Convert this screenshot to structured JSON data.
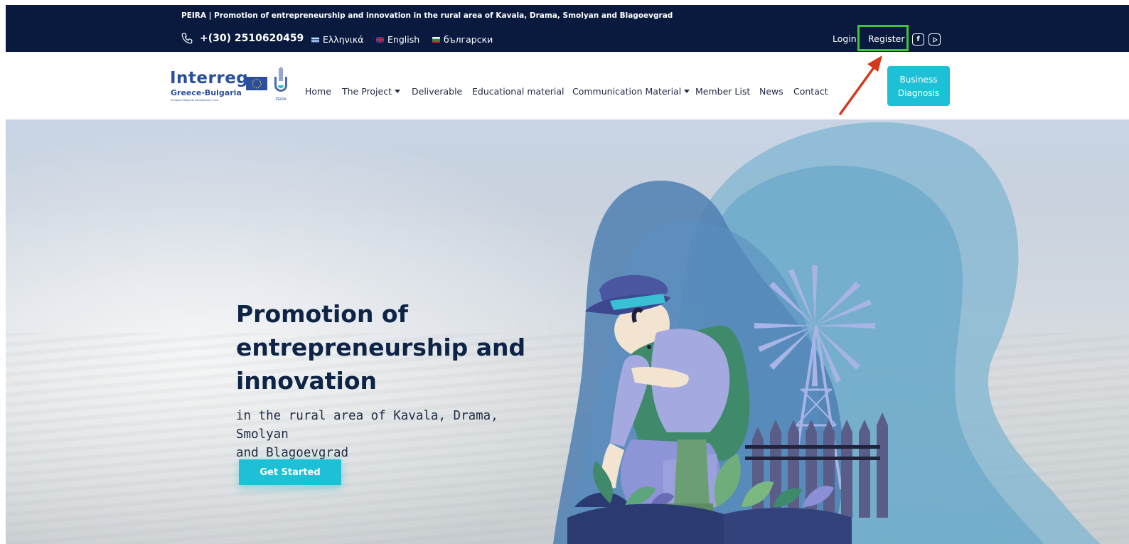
{
  "topbar": {
    "tagline": "PEIRA | Promotion of entrepreneurship and innovation in the rural area of Kavala, Drama, Smolyan and Blagoevgrad",
    "phone": "+(30) 2510620459",
    "languages": [
      "Ελληνικά",
      "English",
      "български"
    ],
    "login": "Login",
    "register": "Register",
    "social_icons": [
      "facebook-icon",
      "youtube-icon"
    ]
  },
  "logo": {
    "title": "Interreg",
    "subtitle": "Greece-Bulgaria",
    "tiny": "European Regional Development Fund",
    "peira": "PEIRA"
  },
  "nav": {
    "items": [
      "Home",
      "The Project",
      "Deliverable",
      "Educational material",
      "Communication Material",
      "Member List",
      "News",
      "Contact"
    ],
    "cta_line1": "Business",
    "cta_line2": "Diagnosis"
  },
  "hero": {
    "line1": "Promotion of",
    "line2": "entrepreneurship and",
    "line3": "innovation",
    "sub_line1": "in the rural area of Kavala, Drama, Smolyan",
    "sub_line2": "and Blagoevgrad",
    "button": "Get Started"
  },
  "colors": {
    "topbar": "#0a1a3f",
    "accent": "#1ec0d6",
    "highlight": "#3bc43c",
    "arrow": "#d13b1b"
  }
}
